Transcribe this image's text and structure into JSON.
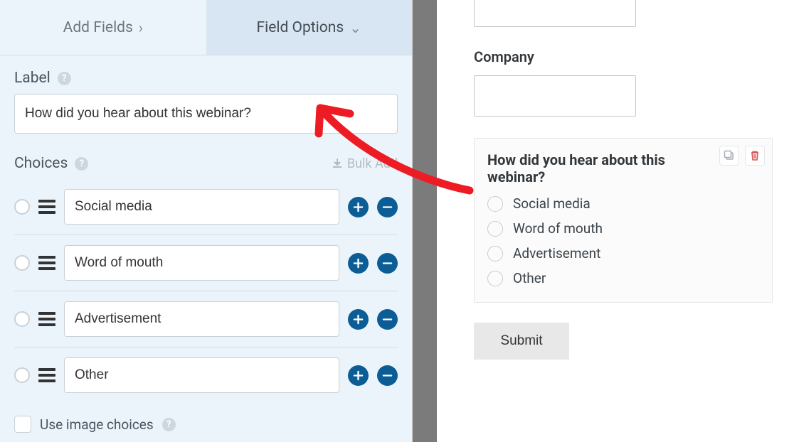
{
  "tabs": {
    "add_fields": "Add Fields",
    "field_options": "Field Options"
  },
  "sections": {
    "label": "Label",
    "choices": "Choices",
    "bulk_add": "Bulk Add",
    "use_image_choices": "Use image choices"
  },
  "label_value": "How did you hear about this webinar?",
  "choices": [
    "Social media",
    "Word of mouth",
    "Advertisement",
    "Other"
  ],
  "preview": {
    "company_label": "Company",
    "question": "How did you hear about this webinar?",
    "options": [
      "Social media",
      "Word of mouth",
      "Advertisement",
      "Other"
    ],
    "submit": "Submit"
  }
}
